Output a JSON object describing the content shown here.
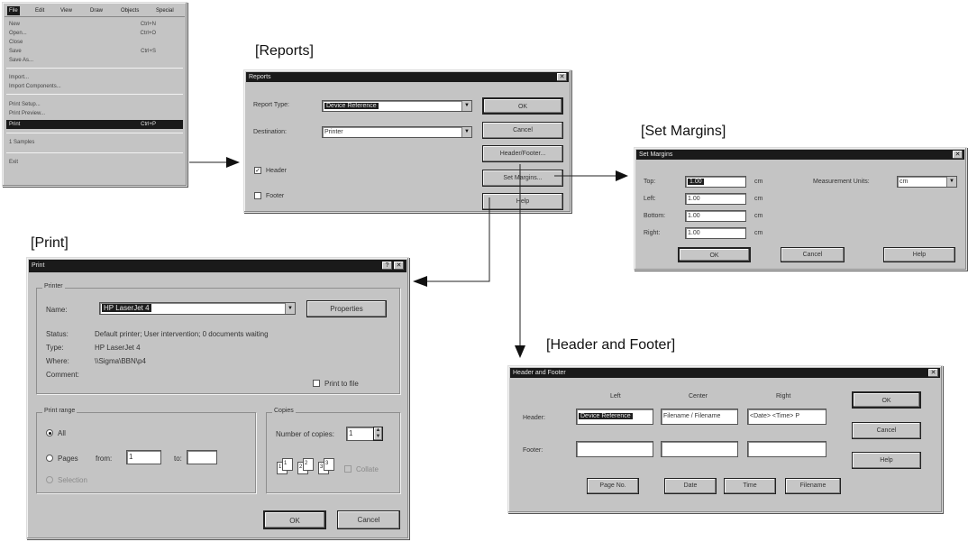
{
  "captions": {
    "reports": "[Reports]",
    "print": "[Print]",
    "set_margins": "[Set Margins]",
    "header_footer": "[Header and Footer]"
  },
  "menu": {
    "bar": [
      "File",
      "Edit",
      "View",
      "Draw",
      "Objects",
      "Special"
    ],
    "items": [
      {
        "label": "New",
        "shortcut": "Ctrl+N"
      },
      {
        "label": "Open...",
        "shortcut": "Ctrl+O"
      },
      {
        "label": "Close",
        "shortcut": ""
      },
      {
        "label": "Save",
        "shortcut": "Ctrl+S"
      },
      {
        "label": "Save As...",
        "shortcut": ""
      },
      {
        "label": "Import...",
        "shortcut": ""
      },
      {
        "label": "Import Components...",
        "shortcut": ""
      },
      {
        "label": "Print Setup...",
        "shortcut": ""
      },
      {
        "label": "Print Preview...",
        "shortcut": ""
      },
      {
        "label": "Print",
        "shortcut": "Ctrl+P"
      },
      {
        "label": "1 Samples",
        "shortcut": ""
      },
      {
        "label": "Exit",
        "shortcut": ""
      }
    ]
  },
  "reports": {
    "title": "Reports",
    "report_type_label": "Report Type:",
    "report_type_value": "Device Reference",
    "destination_label": "Destination:",
    "destination_value": "Printer",
    "header_label": "Header",
    "footer_label": "Footer",
    "ok": "OK",
    "cancel": "Cancel",
    "header_footer": "Header/Footer...",
    "set_margins": "Set Margins...",
    "help": "Help"
  },
  "set_margins": {
    "title": "Set Margins",
    "top_label": "Top:",
    "left_label": "Left:",
    "bottom_label": "Bottom:",
    "right_label": "Right:",
    "top": "1.00",
    "left": "1.00",
    "bottom": "1.00",
    "right": "1.00",
    "unit": "cm",
    "measurement_label": "Measurement Units:",
    "measurement_value": "cm",
    "ok": "OK",
    "cancel": "Cancel",
    "help": "Help"
  },
  "print": {
    "title": "Print",
    "printer_group": "Printer",
    "name_label": "Name:",
    "name_value": "HP LaserJet 4",
    "properties": "Properties",
    "status_label": "Status:",
    "status_value": "Default printer; User intervention; 0 documents waiting",
    "type_label": "Type:",
    "type_value": "HP LaserJet 4",
    "where_label": "Where:",
    "where_value": "\\\\Sigma\\BBN\\p4",
    "comment_label": "Comment:",
    "print_to_file": "Print to file",
    "range_group": "Print range",
    "all": "All",
    "pages": "Pages",
    "from_label": "from:",
    "from_value": "1",
    "to_label": "to:",
    "to_value": "",
    "selection": "Selection",
    "copies_group": "Copies",
    "num_copies_label": "Number of copies:",
    "num_copies_value": "1",
    "collate": "Collate",
    "ok": "OK",
    "cancel": "Cancel"
  },
  "header_footer": {
    "title": "Header and Footer",
    "col_left": "Left",
    "col_center": "Center",
    "col_right": "Right",
    "header_label": "Header:",
    "footer_label": "Footer:",
    "header_left": "Device Reference",
    "header_center": "Filename / Filename",
    "header_right": "<Date> <Time> P",
    "footer_left": "",
    "footer_center": "",
    "footer_right": "",
    "page_no": "Page No.",
    "date": "Date",
    "time": "Time",
    "filename": "Filename",
    "ok": "OK",
    "cancel": "Cancel",
    "help": "Help"
  }
}
